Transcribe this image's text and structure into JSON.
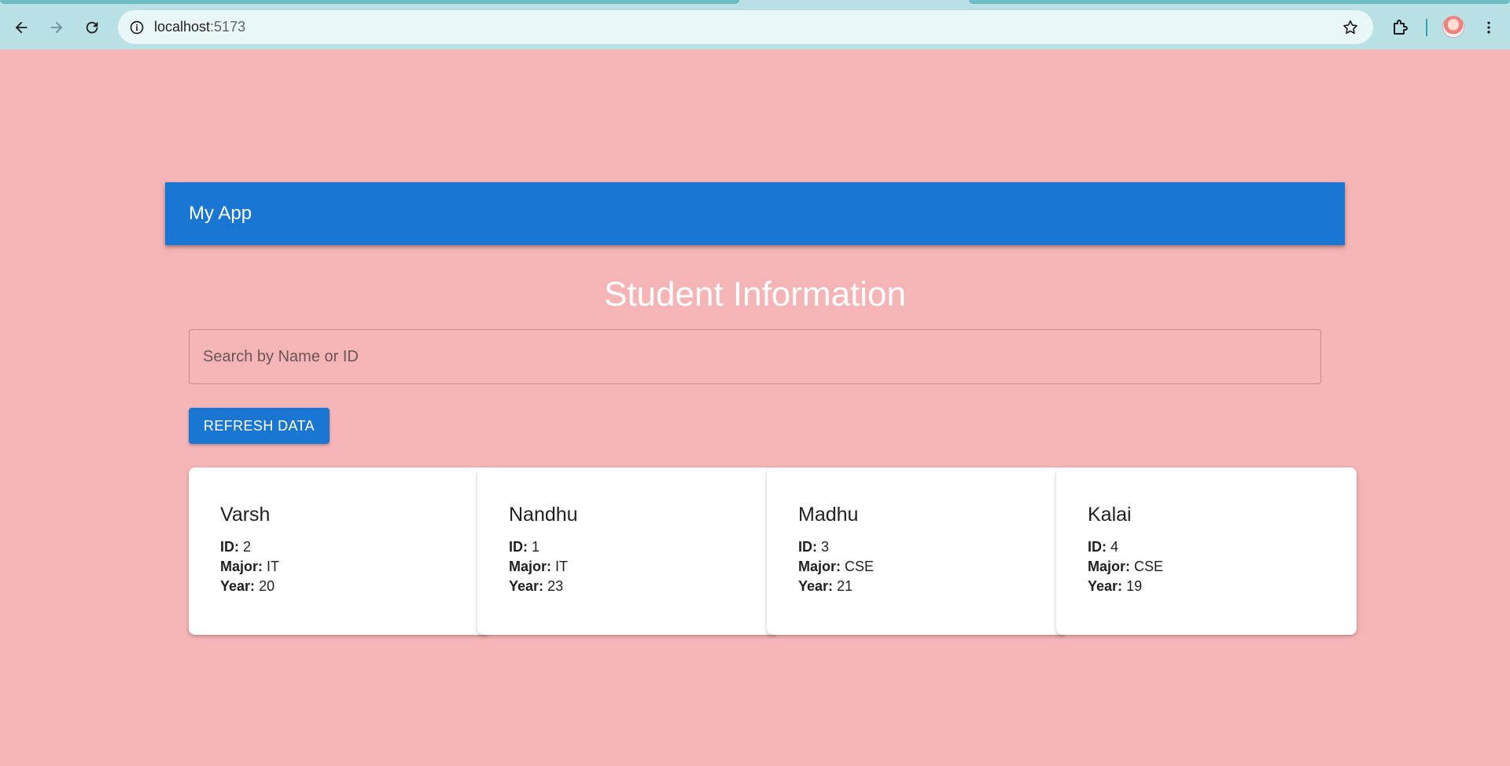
{
  "browser": {
    "url_host": "localhost",
    "url_port": ":5173"
  },
  "app": {
    "title": "My App",
    "page_title": "Student Information",
    "search": {
      "placeholder": "Search by Name or ID",
      "value": ""
    },
    "refresh_label": "REFRESH DATA",
    "field_labels": {
      "id": "ID:",
      "major": "Major:",
      "year": "Year:"
    },
    "students": [
      {
        "name": "Varsh",
        "id": "2",
        "major": "IT",
        "year": "20"
      },
      {
        "name": "Nandhu",
        "id": "1",
        "major": "IT",
        "year": "23"
      },
      {
        "name": "Madhu",
        "id": "3",
        "major": "CSE",
        "year": "21"
      },
      {
        "name": "Kalai",
        "id": "4",
        "major": "CSE",
        "year": "19"
      }
    ]
  },
  "colors": {
    "page_bg": "#f5b4b6",
    "primary": "#1976d2",
    "chrome_bg": "#b9e1e5"
  }
}
